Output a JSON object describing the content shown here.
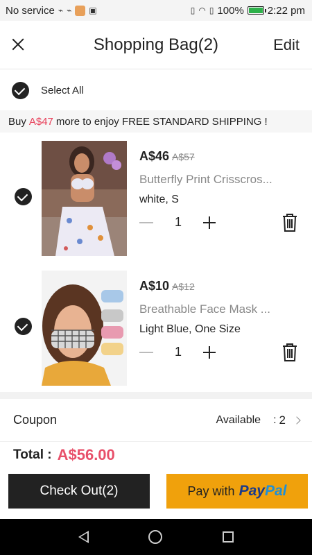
{
  "status": {
    "carrier": "No service",
    "battery": "100%",
    "time": "2:22 pm"
  },
  "header": {
    "title": "Shopping Bag(2)",
    "edit_label": "Edit"
  },
  "select_all": {
    "label": "Select All"
  },
  "banner": {
    "prefix": "Buy",
    "amount": "A$47",
    "suffix": "more to enjoy FREE STANDARD SHIPPING !"
  },
  "items": [
    {
      "price": "A$46",
      "old_price": "A$57",
      "name": "Butterfly Print Crisscros...",
      "variant": "white, S",
      "qty": "1"
    },
    {
      "price": "A$10",
      "old_price": "A$12",
      "name": "Breathable Face Mask ...",
      "variant": "Light Blue, One Size",
      "qty": "1"
    }
  ],
  "coupon": {
    "label": "Coupon",
    "available": "Available",
    "colon": ":",
    "count": "2"
  },
  "total": {
    "label": "Total :",
    "amount": "A$56.00"
  },
  "buttons": {
    "checkout": "Check Out(2)",
    "paypal_prefix": "Pay with",
    "paypal_logo_a": "Pay",
    "paypal_logo_b": "Pal"
  },
  "colors": {
    "accent": "#e8405a",
    "checkout_bg": "#222222",
    "paypal_bg": "#f0a10c"
  }
}
